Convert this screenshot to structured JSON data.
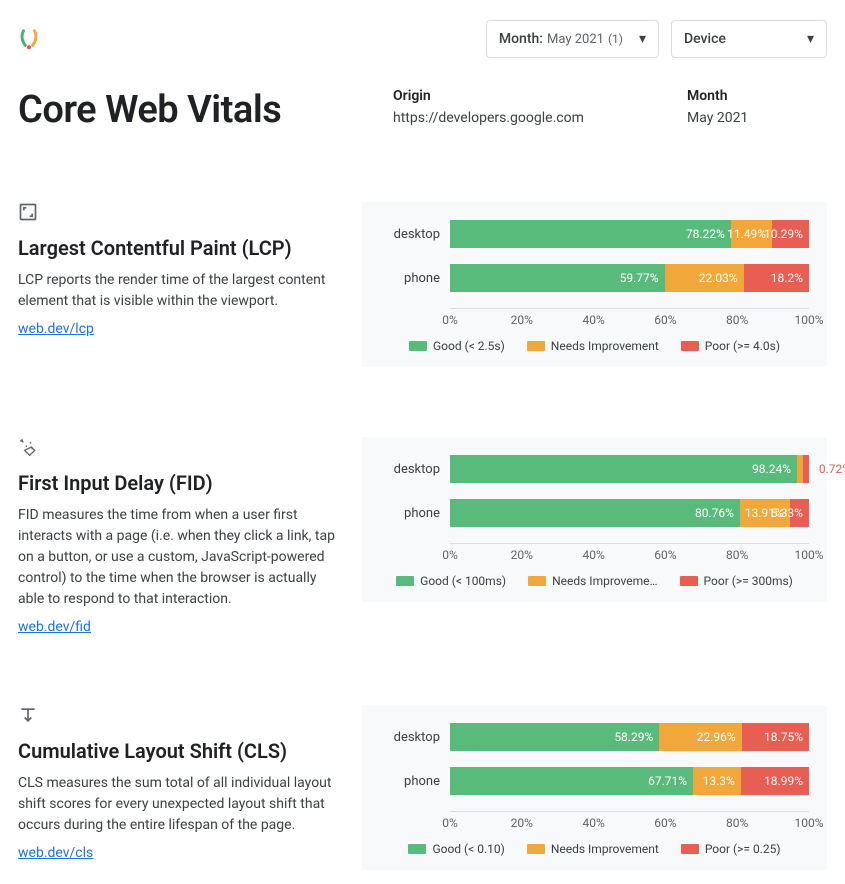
{
  "header": {
    "month_selector_label": "Month:",
    "month_selector_value": "May 2021",
    "month_selector_count": "(1)",
    "device_selector_label": "Device"
  },
  "title": "Core Web Vitals",
  "meta": {
    "origin_label": "Origin",
    "origin_value": "https://developers.google.com",
    "month_label": "Month",
    "month_value": "May 2021"
  },
  "axis_ticks": [
    "0%",
    "20%",
    "40%",
    "60%",
    "80%",
    "100%"
  ],
  "metrics": [
    {
      "key": "lcp",
      "title": "Largest Contentful Paint (LCP)",
      "desc": "LCP reports the render time of the largest content element that is visible within the viewport.",
      "link_text": "web.dev/lcp",
      "legend": {
        "good": "Good (< 2.5s)",
        "ni": "Needs Improvement",
        "poor": "Poor (>= 4.0s)"
      }
    },
    {
      "key": "fid",
      "title": "First Input Delay (FID)",
      "desc": "FID measures the time from when a user first interacts with a page (i.e. when they click a link, tap on a button, or use a custom, JavaScript-powered control) to the time when the browser is actually able to respond to that interaction.",
      "link_text": "web.dev/fid",
      "legend": {
        "good": "Good (< 100ms)",
        "ni": "Needs Improveme…",
        "poor": "Poor (>= 300ms)"
      }
    },
    {
      "key": "cls",
      "title": "Cumulative Layout Shift (CLS)",
      "desc": "CLS measures the sum total of all individual layout shift scores for every unexpected layout shift that occurs during the entire lifespan of the page.",
      "link_text": "web.dev/cls",
      "legend": {
        "good": "Good (< 0.10)",
        "ni": "Needs Improvement",
        "poor": "Poor (>= 0.25)"
      }
    }
  ],
  "chart_data": [
    {
      "type": "bar",
      "metric": "LCP",
      "categories": [
        "desktop",
        "phone"
      ],
      "series": [
        {
          "name": "Good",
          "values": [
            78.22,
            59.77
          ]
        },
        {
          "name": "Needs Improvement",
          "values": [
            11.49,
            22.03
          ]
        },
        {
          "name": "Poor",
          "values": [
            10.29,
            18.2
          ]
        }
      ],
      "xlabel": "",
      "ylabel": "",
      "ylim": [
        0,
        100
      ],
      "unit": "%"
    },
    {
      "type": "bar",
      "metric": "FID",
      "categories": [
        "desktop",
        "phone"
      ],
      "series": [
        {
          "name": "Good",
          "values": [
            98.24,
            80.76
          ]
        },
        {
          "name": "Needs Improvement",
          "values": [
            1.04,
            13.91
          ]
        },
        {
          "name": "Poor",
          "values": [
            0.72,
            5.33
          ]
        }
      ],
      "xlabel": "",
      "ylabel": "",
      "ylim": [
        0,
        100
      ],
      "unit": "%"
    },
    {
      "type": "bar",
      "metric": "CLS",
      "categories": [
        "desktop",
        "phone"
      ],
      "series": [
        {
          "name": "Good",
          "values": [
            58.29,
            67.71
          ]
        },
        {
          "name": "Needs Improvement",
          "values": [
            22.96,
            13.3
          ]
        },
        {
          "name": "Poor",
          "values": [
            18.75,
            18.99
          ]
        }
      ],
      "xlabel": "",
      "ylabel": "",
      "ylim": [
        0,
        100
      ],
      "unit": "%"
    }
  ]
}
